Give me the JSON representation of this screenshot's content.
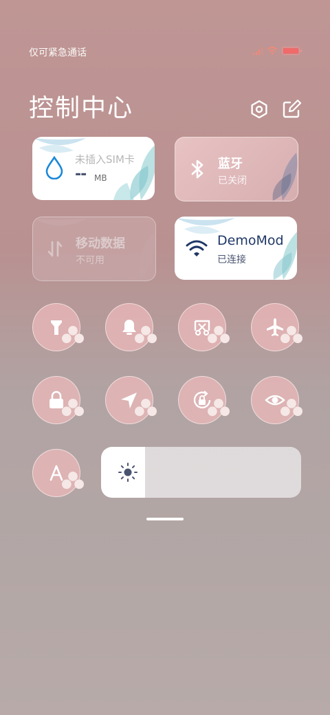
{
  "status": {
    "text": "仅可紧急通话"
  },
  "header": {
    "title": "控制中心"
  },
  "tiles": {
    "data_usage": {
      "name": "未插入SIM卡",
      "value": "--",
      "unit": "MB"
    },
    "bluetooth": {
      "name": "蓝牙",
      "status": "已关闭"
    },
    "mobile_data": {
      "name": "移动数据",
      "status": "不可用"
    },
    "wifi": {
      "name": "DemoMod",
      "status": "已连接"
    }
  },
  "toggles": [
    "flashlight-icon",
    "bell-icon",
    "screenshot-icon",
    "airplane-icon",
    "lock-icon",
    "location-icon",
    "rotation-lock-icon",
    "eye-icon",
    "auto-brightness-icon"
  ],
  "brightness": {
    "level": 0.22
  },
  "colors": {
    "accent_blue": "#1a88d8",
    "wifi_navy": "#1f3766",
    "battery": "#f06a6a"
  }
}
